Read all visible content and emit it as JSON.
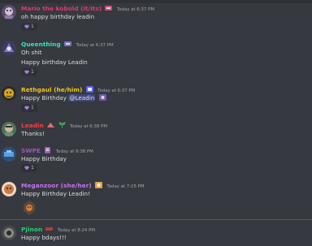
{
  "messages": [
    {
      "username": "Mario the kobold (it/its)",
      "name_color": "#d63c72",
      "timestamp": "Today at 6:37 PM",
      "lines": [
        "oh happy birthday leadin"
      ],
      "reaction": {
        "emoji": "purple-heart",
        "count": "1"
      }
    },
    {
      "username": "Queenthing",
      "name_color": "#2fe4c2",
      "timestamp": "Today at 6:37 PM",
      "lines": [
        "Oh shit",
        "Happy birthday Leadin"
      ],
      "reaction": {
        "emoji": "purple-heart",
        "count": "1"
      }
    },
    {
      "username": "Rethgaul (he/him)",
      "name_color": "#f1c40f",
      "timestamp": "Today at 6:37 PM",
      "lines": [
        "Happy Birthday"
      ],
      "mention": "@Leadin",
      "reaction": {
        "emoji": "purple-heart",
        "count": "1"
      }
    },
    {
      "username": "Leadin",
      "name_color": "#ed4245",
      "timestamp": "Today at 6:38 PM",
      "lines": [
        "Thanks!"
      ]
    },
    {
      "username": "SWPE",
      "name_color": "#9b59b6",
      "timestamp": "Today at 6:38 PM",
      "lines": [
        "Happy Birthday"
      ],
      "reaction": {
        "emoji": "purple-heart",
        "count": "1"
      }
    },
    {
      "username": "Meganzoor (she/her)",
      "name_color": "#c770f0",
      "timestamp": "Today at 7:25 PM",
      "lines": [
        "Happy Birthday Leadin!"
      ]
    },
    {
      "username": "Pjinon",
      "name_color": "#2ecc71",
      "timestamp": "Today at 8:24 PM",
      "lines": [
        "Happy bdays!!!"
      ]
    }
  ]
}
